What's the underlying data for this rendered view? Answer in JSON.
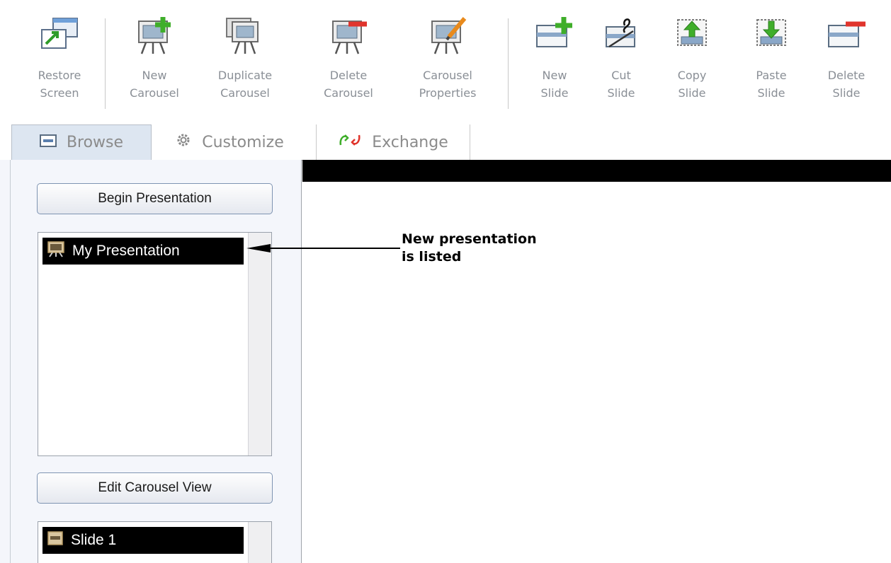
{
  "toolbar": {
    "buttons": [
      {
        "label": "Restore\nScreen",
        "icon": "restore-screen-icon"
      },
      {
        "label": "New\nCarousel",
        "icon": "new-carousel-icon"
      },
      {
        "label": "Duplicate\nCarousel",
        "icon": "duplicate-carousel-icon"
      },
      {
        "label": "Delete\nCarousel",
        "icon": "delete-carousel-icon"
      },
      {
        "label": "Carousel\nProperties",
        "icon": "carousel-properties-icon"
      },
      {
        "label": "New\nSlide",
        "icon": "new-slide-icon"
      },
      {
        "label": "Cut\nSlide",
        "icon": "cut-slide-icon"
      },
      {
        "label": "Copy\nSlide",
        "icon": "copy-slide-icon"
      },
      {
        "label": "Paste\nSlide",
        "icon": "paste-slide-icon"
      },
      {
        "label": "Delete\nSlide",
        "icon": "delete-slide-icon"
      }
    ]
  },
  "tabs": [
    {
      "label": "Browse",
      "icon": "browse-icon",
      "active": true
    },
    {
      "label": "Customize",
      "icon": "gear-icon",
      "active": false
    },
    {
      "label": "Exchange",
      "icon": "exchange-icon",
      "active": false
    }
  ],
  "left_panel": {
    "begin_button": "Begin Presentation",
    "presentations": [
      {
        "name": "My Presentation",
        "icon": "presentation-icon"
      }
    ],
    "edit_button": "Edit Carousel View",
    "slides": [
      {
        "name": "Slide 1",
        "icon": "slide-icon"
      }
    ]
  },
  "annotation": {
    "text": "New presentation\nis listed"
  },
  "colors": {
    "active_tab": "#dde6f1",
    "selection": "#000000",
    "accent_green": "#3fae2a",
    "accent_red": "#e0342c"
  }
}
